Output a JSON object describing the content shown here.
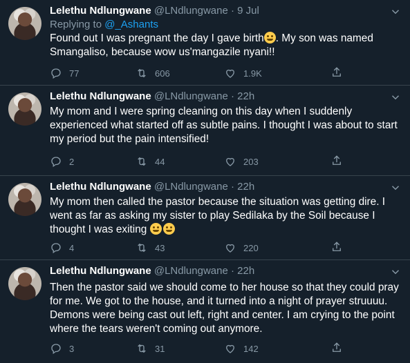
{
  "tweets": [
    {
      "name": "Lelethu Ndlungwane",
      "handle": "@LNdlungwane",
      "dot": "·",
      "time": "9 Jul",
      "replying_prefix": "Replying to ",
      "replying_to": "@_Ashants",
      "text_before_emoji": "Found out I was pregnant the day I gave birth",
      "text_after_emoji": ". My son was named Smangaliso, because wow us'mangazile nyani!!",
      "replies": "77",
      "retweets": "606",
      "likes": "1.9K"
    },
    {
      "name": "Lelethu Ndlungwane",
      "handle": "@LNdlungwane",
      "dot": "·",
      "time": "22h",
      "text": "My mom and I were spring cleaning on this day when I suddenly experienced what started off as subtle pains. I thought I was about to start my period but the pain intensified!",
      "replies": "2",
      "retweets": "44",
      "likes": "203"
    },
    {
      "name": "Lelethu Ndlungwane",
      "handle": "@LNdlungwane",
      "dot": "·",
      "time": "22h",
      "text": "My mom then called the pastor because the situation was getting dire. I went as far as asking my sister to play Sedilaka by the Soil because I thought I was exiting",
      "replies": "4",
      "retweets": "43",
      "likes": "220"
    },
    {
      "name": "Lelethu Ndlungwane",
      "handle": "@LNdlungwane",
      "dot": "·",
      "time": "22h",
      "text": "Then the pastor  said we should come to her house so that they could pray for me. We got to the house, and it turned into a night of prayer struuuu. Demons were being cast out left, right and center. I am crying to the point where the tears weren't coming out anymore.",
      "replies": "3",
      "retweets": "31",
      "likes": "142"
    }
  ],
  "icons": {
    "reply": "reply-icon",
    "retweet": "retweet-icon",
    "like": "heart-icon",
    "share": "share-icon",
    "more": "chevron-down-icon",
    "emoji": "emoji-icon"
  },
  "colors": {
    "background": "#15202b",
    "divider": "#38444d",
    "muted": "#8899a6",
    "link": "#1da1f2"
  }
}
